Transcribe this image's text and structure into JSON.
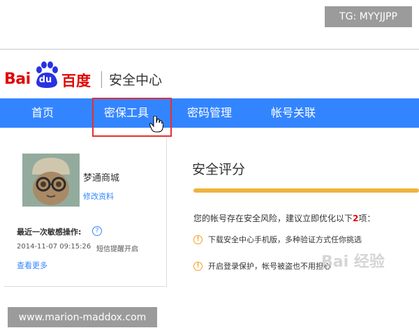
{
  "overlay": {
    "tg_handle": "TG: MYYJJPP",
    "site": "www.marion-maddox.com"
  },
  "header": {
    "logo_bai": "Bai",
    "logo_du": "du",
    "logo_baidu_cn": "百度",
    "title": "安全中心"
  },
  "nav": {
    "items": [
      {
        "label": "首页"
      },
      {
        "label": "密保工具"
      },
      {
        "label": "密码管理"
      },
      {
        "label": "帐号关联"
      }
    ],
    "highlighted_index": 1
  },
  "profile": {
    "username": "梦通商城",
    "edit_label": "修改资料",
    "recent_label": "最近一次敏感操作:",
    "help_icon": "?",
    "recent_time": "2014-11-07 09:15:26",
    "recent_method": "短信提醒开启",
    "view_more": "查看更多"
  },
  "score": {
    "title": "安全评分",
    "progress_fraction": 1.0,
    "bar_color": "#f0b33d",
    "risk_prefix": "您的帐号存在安全风险，建议立即优化以下",
    "risk_count": "2",
    "risk_suffix": "项：",
    "suggestions": [
      {
        "icon": "warning-icon",
        "text": "下载安全中心手机版，多种验证方式任你挑选"
      },
      {
        "icon": "warning-icon",
        "text": "开启登录保护，帐号被盗也不用担心"
      }
    ]
  },
  "watermark": {
    "text": "Bai 经验"
  },
  "colors": {
    "brand_red": "#e10602",
    "nav_blue": "#3385ff",
    "highlight_red": "#e53030",
    "warning_orange": "#f0a020"
  }
}
